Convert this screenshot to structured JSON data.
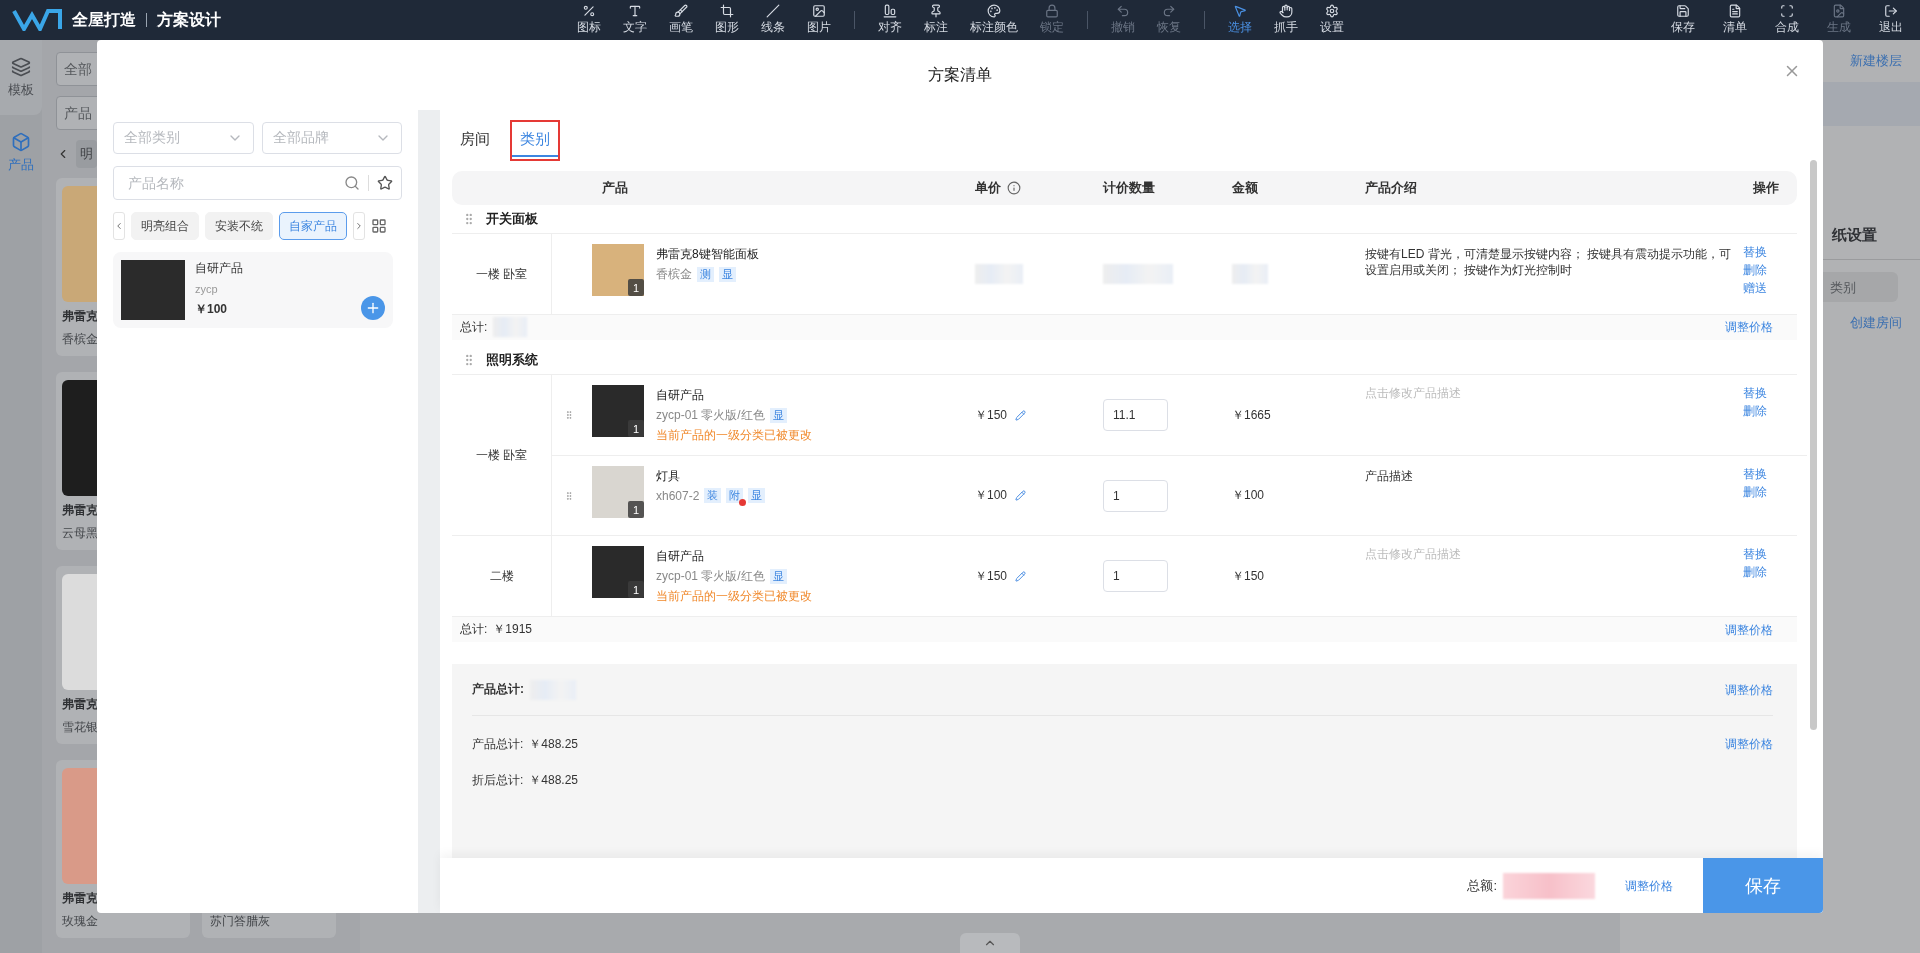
{
  "app": {
    "title": "全屋打造",
    "subtitle": "方案设计"
  },
  "toolbar": {
    "groups": [
      [
        {
          "label": "图标",
          "disabled": false,
          "selected": false
        },
        {
          "label": "文字",
          "disabled": false,
          "selected": false
        },
        {
          "label": "画笔",
          "disabled": false,
          "selected": false
        },
        {
          "label": "图形",
          "disabled": false,
          "selected": false
        },
        {
          "label": "线条",
          "disabled": false,
          "selected": false
        },
        {
          "label": "图片",
          "disabled": false,
          "selected": false
        }
      ],
      [
        {
          "label": "对齐",
          "disabled": false,
          "selected": false
        },
        {
          "label": "标注",
          "disabled": false,
          "selected": false
        },
        {
          "label": "标注颜色",
          "disabled": false,
          "selected": false
        },
        {
          "label": "锁定",
          "disabled": true,
          "selected": false
        }
      ],
      [
        {
          "label": "撤销",
          "disabled": true,
          "selected": false
        },
        {
          "label": "恢复",
          "disabled": true,
          "selected": false
        }
      ],
      [
        {
          "label": "选择",
          "disabled": false,
          "selected": true
        },
        {
          "label": "抓手",
          "disabled": false,
          "selected": false
        },
        {
          "label": "设置",
          "disabled": false,
          "selected": false
        }
      ]
    ],
    "right": [
      {
        "label": "保存",
        "disabled": false,
        "selected": false
      },
      {
        "label": "清单",
        "disabled": false,
        "selected": false
      },
      {
        "label": "合成",
        "disabled": false,
        "selected": false
      },
      {
        "label": "生成",
        "disabled": true,
        "selected": false
      },
      {
        "label": "退出",
        "disabled": false,
        "selected": false
      }
    ]
  },
  "side_nav": [
    {
      "label": "模板",
      "selected": false
    },
    {
      "label": "产品",
      "selected": true
    }
  ],
  "background_list": {
    "filter": "全部",
    "search": "产品",
    "chip": "明",
    "cards": [
      {
        "name": "弗雷克",
        "variant": "香槟金",
        "color": "#c9a877"
      },
      {
        "name": "弗雷克",
        "variant": "云母黑",
        "color": "#1e1e1e"
      },
      {
        "name": "弗雷克",
        "variant": "雪花银",
        "color": "#dcdcdc"
      },
      {
        "name": "弗雷克",
        "variant": "玫瑰金",
        "color": "#d99a88"
      }
    ],
    "second_column_caption": "苏门答腊灰"
  },
  "background_panel": {
    "new_floor": "新建楼层",
    "drawing_settings": "纸设置",
    "category_placeholder": "类别",
    "create_room": "创建房间"
  },
  "dialog": {
    "title": "方案清单"
  },
  "picker": {
    "category_select": "全部类别",
    "brand_select": "全部品牌",
    "search_placeholder": "产品名称",
    "chips": [
      {
        "label": "明亮组合",
        "selected": false
      },
      {
        "label": "安装不统",
        "selected": false
      },
      {
        "label": "自家产品",
        "selected": true
      }
    ],
    "products": [
      {
        "name": "自研产品",
        "code": "zycp",
        "price": "￥100"
      }
    ]
  },
  "view_tabs": [
    {
      "label": "房间",
      "selected": false
    },
    {
      "label": "类别",
      "selected": true
    }
  ],
  "table": {
    "columns": [
      {
        "label": "产品"
      },
      {
        "label": "单价",
        "info": true
      },
      {
        "label": "计价数量"
      },
      {
        "label": "金额"
      },
      {
        "label": "产品介绍"
      },
      {
        "label": "操作"
      }
    ],
    "groups": [
      {
        "name": "开关面板",
        "rooms": [
          {
            "room": "一楼 卧室",
            "items": [
              {
                "name": "弗雷克8键智能面板",
                "spec": "香槟金",
                "count": "1",
                "color": "#d8b27c",
                "draggable": false,
                "redacted": true,
                "tags": [
                  {
                    "label": "测",
                    "alert": false
                  },
                  {
                    "label": "显",
                    "alert": false
                  }
                ],
                "desc": "按键有LED 背光，可清楚显示按键内容； 按键具有震动提示功能，可设置启用或关闭； 按键作为灯光控制时",
                "desc_is_placeholder": false,
                "actions": [
                  "替换",
                  "删除",
                  "赠送"
                ]
              }
            ]
          }
        ],
        "subtotal_label": "总计:",
        "subtotal_redacted": true,
        "adjust": "调整价格"
      },
      {
        "name": "照明系统",
        "rooms": [
          {
            "room": "一楼 卧室",
            "items": [
              {
                "name": "自研产品",
                "spec": "zycp-01 零火版/红色",
                "count": "1",
                "color": "#2a2a2a",
                "draggable": true,
                "redacted": false,
                "price": "￥150",
                "quantity": "11.1",
                "amount": "￥1665",
                "tags": [
                  {
                    "label": "显",
                    "alert": false
                  }
                ],
                "warning": "当前产品的一级分类已被更改",
                "desc": "点击修改产品描述",
                "desc_is_placeholder": true,
                "actions": [
                  "替换",
                  "删除"
                ]
              },
              {
                "name": "灯具",
                "spec": "xh607-2",
                "count": "1",
                "color": "#d9d6d0",
                "draggable": true,
                "redacted": false,
                "price": "￥100",
                "quantity": "1",
                "amount": "￥100",
                "tags": [
                  {
                    "label": "装",
                    "alert": false
                  },
                  {
                    "label": "附",
                    "alert": true
                  },
                  {
                    "label": "显",
                    "alert": false
                  }
                ],
                "desc": "产品描述",
                "desc_is_placeholder": false,
                "actions": [
                  "替换",
                  "删除"
                ]
              }
            ]
          },
          {
            "room": "二楼",
            "items": [
              {
                "name": "自研产品",
                "spec": "zycp-01 零火版/红色",
                "count": "1",
                "color": "#2a2a2a",
                "draggable": false,
                "redacted": false,
                "price": "￥150",
                "quantity": "1",
                "amount": "￥150",
                "tags": [
                  {
                    "label": "显",
                    "alert": false
                  }
                ],
                "warning": "当前产品的一级分类已被更改",
                "desc": "点击修改产品描述",
                "desc_is_placeholder": true,
                "actions": [
                  "替换",
                  "删除"
                ]
              }
            ]
          }
        ],
        "subtotal_label": "总计:",
        "subtotal": "￥1915",
        "adjust": "调整价格"
      }
    ]
  },
  "summary": [
    {
      "label": "产品总计:",
      "redacted": true,
      "bold": true,
      "action": "调整价格"
    },
    {
      "label": "产品总计:",
      "value": "￥488.25",
      "bold": false,
      "action": "调整价格"
    },
    {
      "label": "折后总计:",
      "value": "￥488.25",
      "bold": false
    }
  ],
  "footer": {
    "total_label": "总额:",
    "total_redacted": true,
    "adjust": "调整价格",
    "save": "保存"
  }
}
